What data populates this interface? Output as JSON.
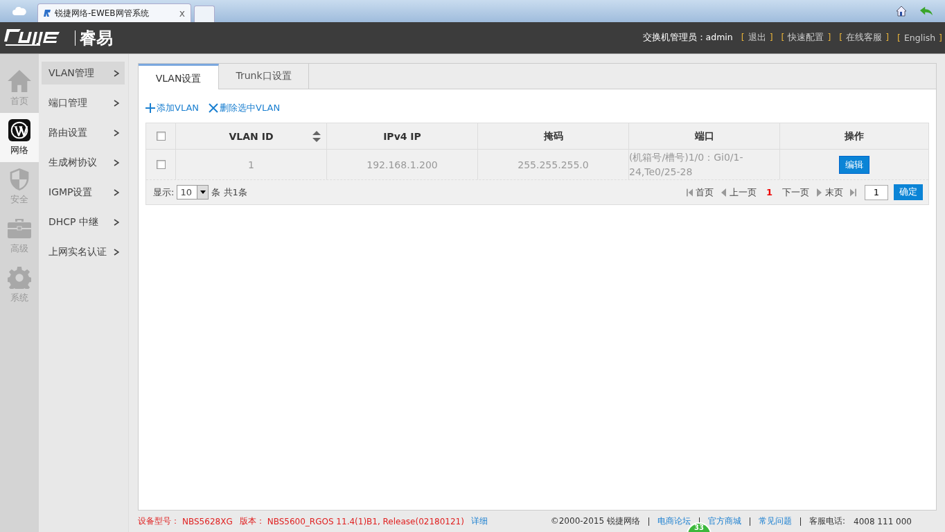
{
  "browser": {
    "tab_title": "锐捷网络-EWEB网管系统",
    "tab_close": "x"
  },
  "header": {
    "logo_text": "睿易",
    "user_label": "交换机管理员：admin",
    "links": [
      {
        "open": "[",
        "label": "退出",
        "close": "]"
      },
      {
        "open": "[",
        "label": "快速配置",
        "close": "]"
      },
      {
        "open": "[",
        "label": "在线客服",
        "close": "]"
      },
      {
        "open": "[",
        "label": "English",
        "close": "]"
      }
    ]
  },
  "rail": [
    {
      "kind": "home",
      "label": "首页",
      "selected": false
    },
    {
      "kind": "network",
      "label": "网络",
      "selected": true
    },
    {
      "kind": "shield",
      "label": "安全",
      "selected": false
    },
    {
      "kind": "briefcase",
      "label": "高级",
      "selected": false
    },
    {
      "kind": "gear",
      "label": "系统",
      "selected": false
    }
  ],
  "submenu": [
    {
      "label": "VLAN管理",
      "selected": true
    },
    {
      "label": "端口管理",
      "selected": false
    },
    {
      "label": "路由设置",
      "selected": false
    },
    {
      "label": "生成树协议",
      "selected": false
    },
    {
      "label": "IGMP设置",
      "selected": false
    },
    {
      "label": "DHCP 中继",
      "selected": false
    },
    {
      "label": "上网实名认证",
      "selected": false
    }
  ],
  "tabs": [
    {
      "label": "VLAN设置",
      "selected": true
    },
    {
      "label": "Trunk口设置",
      "selected": false
    }
  ],
  "actions": [
    {
      "kind": "add",
      "label": "添加VLAN"
    },
    {
      "kind": "delete",
      "label": "删除选中VLAN"
    }
  ],
  "table": {
    "columns": [
      "VLAN ID",
      "IPv4 IP",
      "掩码",
      "端口",
      "操作"
    ],
    "header_checked": false,
    "rows": [
      {
        "checked": false,
        "vlan_id": "1",
        "ipv4": "192.168.1.200",
        "mask": "255.255.255.0",
        "ports": "(机箱号/槽号)1/0：Gi0/1-24,Te0/25-28",
        "action": "编辑"
      }
    ]
  },
  "pager": {
    "show_label": "显示:",
    "page_size": "10",
    "count_text": "条 共1条",
    "first": "首页",
    "prev": "上一页",
    "current": "1",
    "next": "下一页",
    "last": "末页",
    "jump_value": "1",
    "confirm": "确定"
  },
  "footer": {
    "model_label": "设备型号：",
    "model": "NBS5628XG",
    "version_label": "版本：",
    "version": "NBS5600_RGOS 11.4(1)B1, Release(02180121)",
    "details": "详细",
    "copyright": "©2000-2015 锐捷网络",
    "links": [
      "电商论坛",
      "官方商城",
      "常见问题"
    ],
    "phone_label": "客服电话:",
    "phone": "4008 111 000"
  },
  "badge": "33"
}
